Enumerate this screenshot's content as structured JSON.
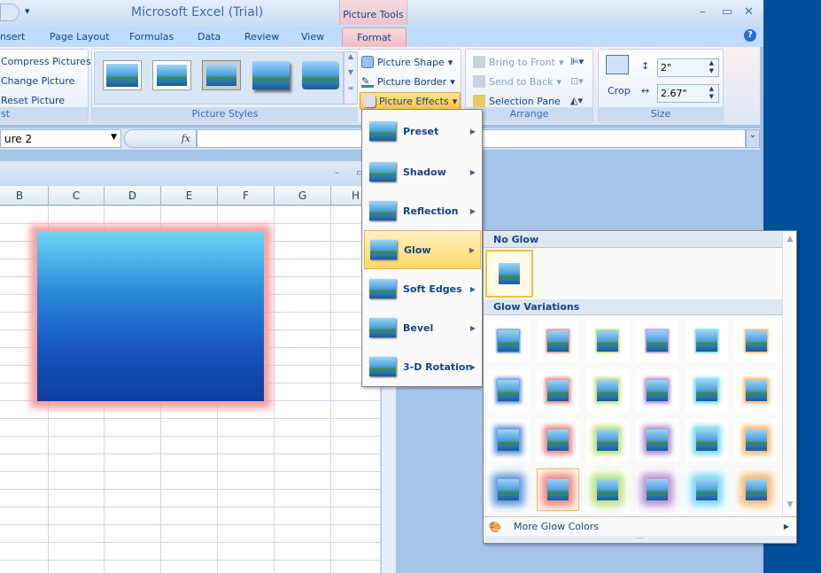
{
  "window": {
    "title": "Microsoft Excel (Trial)",
    "contextual_tab": "Picture Tools"
  },
  "tabs": [
    "nsert",
    "Page Layout",
    "Formulas",
    "Data",
    "Review",
    "View"
  ],
  "active_tab": "Format",
  "adjust": {
    "items": [
      "Compress Pictures",
      "Change Picture",
      "Reset Picture"
    ],
    "label": "st"
  },
  "styles": {
    "label": "Picture Styles",
    "shape": "Picture Shape",
    "border": "Picture Border",
    "effects": "Picture Effects"
  },
  "arrange": {
    "label": "Arrange",
    "front": "Bring to Front",
    "back": "Send to Back",
    "pane": "Selection Pane"
  },
  "size": {
    "label": "Size",
    "crop": "Crop",
    "height": "2\"",
    "width": "2.67\""
  },
  "formula": {
    "name_box": "ure 2",
    "fx": "fx",
    "value": ""
  },
  "columns": [
    "B",
    "C",
    "D",
    "E",
    "F",
    "G",
    "H"
  ],
  "effects_menu": [
    {
      "label": "Preset",
      "key": "P"
    },
    {
      "label": "Shadow",
      "key": "S"
    },
    {
      "label": "Reflection",
      "key": "R"
    },
    {
      "label": "Glow",
      "key": "G",
      "highlighted": true
    },
    {
      "label": "Soft Edges",
      "key": "E"
    },
    {
      "label": "Bevel",
      "key": "B"
    },
    {
      "label": "3-D Rotation",
      "key": "D"
    }
  ],
  "glow_menu": {
    "no_glow": "No Glow",
    "variations": "Glow Variations",
    "more": "More Glow Colors",
    "colors": [
      "#5b8fdc",
      "#f08080",
      "#b5e07a",
      "#b08ad0",
      "#6fd6f4",
      "#f9b46c"
    ],
    "rows": 4,
    "selected": {
      "row": 4,
      "col": 2
    }
  },
  "picture": {
    "glow_color": "#f7a0a0"
  }
}
